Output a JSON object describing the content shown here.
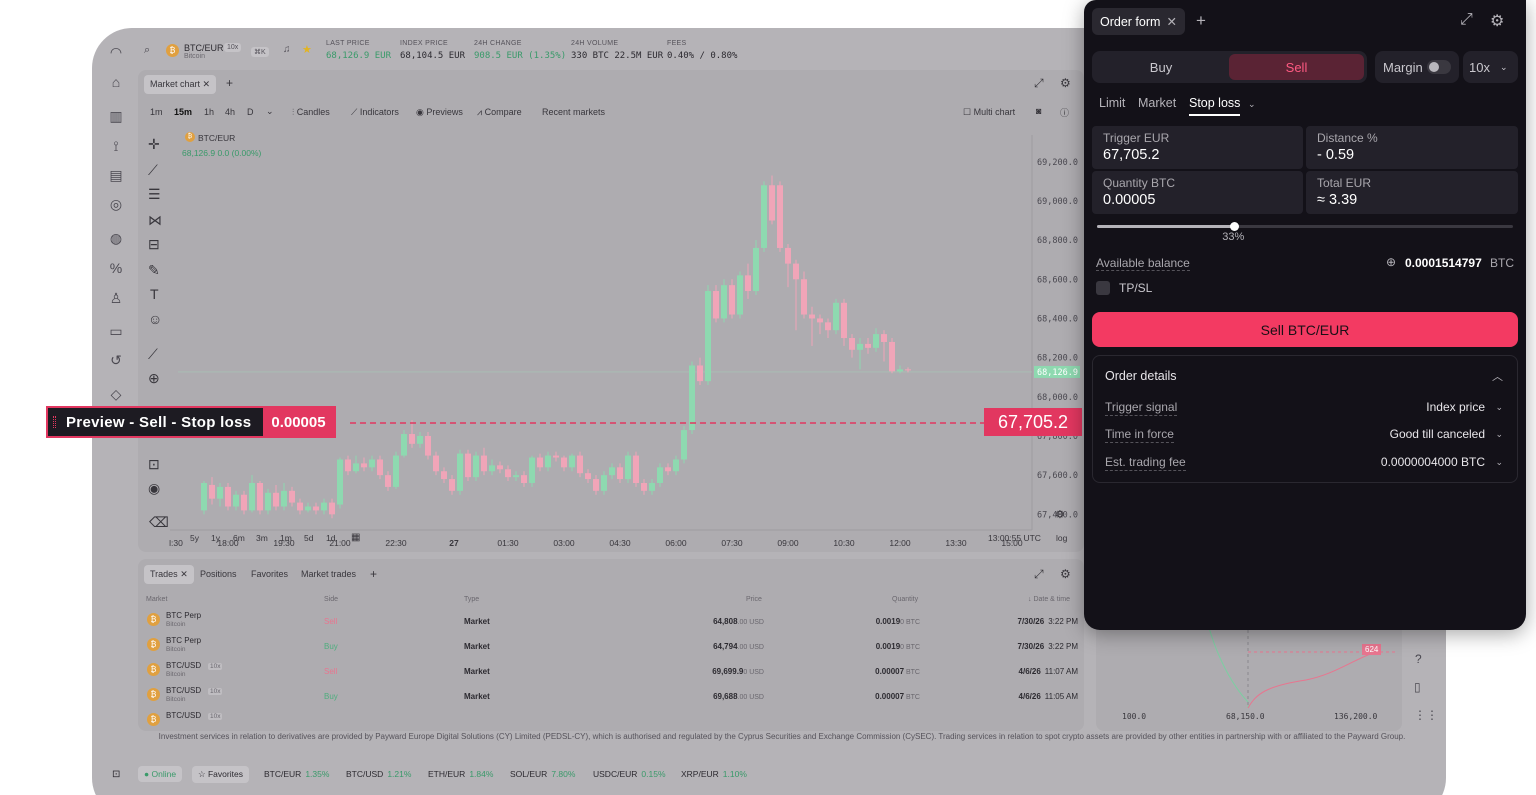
{
  "topbar": {
    "pair": "BTC/EUR",
    "pair_sub": "Bitcoin",
    "leverage_badge": "10x",
    "shortcut": "⌘K",
    "stats": [
      {
        "label": "LAST PRICE",
        "value": "68,126.9 EUR"
      },
      {
        "label": "INDEX PRICE",
        "value": "68,104.5 EUR"
      },
      {
        "label": "24H CHANGE",
        "value": "908.5 EUR (1.35%)"
      },
      {
        "label": "24H VOLUME",
        "value": "330 BTC  22.5M EUR"
      },
      {
        "label": "FEES",
        "value": "0.40% / 0.80%"
      }
    ]
  },
  "chart_panel": {
    "tab": "Market chart",
    "intervals": [
      "1m",
      "15m",
      "1h",
      "4h",
      "D"
    ],
    "tools": [
      "Candles",
      "Indicators",
      "Previews",
      "Compare",
      "Recent markets"
    ],
    "multi_chart": "Multi chart",
    "legend_pair": "BTC/EUR",
    "legend_value": "68,126.9  0.0 (0.00%)",
    "price_ticks": [
      "69,200.0",
      "69,000.0",
      "68,800.0",
      "68,600.0",
      "68,400.0",
      "68,200.0",
      "68,000.0",
      "67,800.0",
      "67,600.0",
      "67,400.0"
    ],
    "current_price_tag": "68,126.9",
    "time_ticks": [
      "l:30",
      "18:00",
      "19:30",
      "21:00",
      "22:30",
      "27",
      "01:30",
      "03:00",
      "04:30",
      "06:00",
      "07:30",
      "09:00",
      "10:30",
      "12:00",
      "13:30",
      "15:00"
    ],
    "ranges": [
      "5y",
      "1y",
      "6m",
      "3m",
      "1m",
      "5d",
      "1d"
    ],
    "clock": "13:00:55 UTC",
    "scale": "log"
  },
  "preview": {
    "label": "Preview - Sell - Stop loss",
    "qty": "0.00005",
    "price": "67,705.2"
  },
  "trades_panel": {
    "tabs": [
      "Trades",
      "Positions",
      "Favorites",
      "Market trades"
    ],
    "columns": [
      "Market",
      "Side",
      "Type",
      "Price",
      "Quantity",
      "Date & time"
    ],
    "rows": [
      {
        "market": "BTC Perp",
        "sub": "Bitcoin",
        "badge": "",
        "side": "Sell",
        "type": "Market",
        "price_main": "64,808",
        "price_dec": ".00 USD",
        "qty_main": "0.0019",
        "qty_dec": "0 BTC",
        "date": "7/30/26",
        "time": "3:22 PM"
      },
      {
        "market": "BTC Perp",
        "sub": "Bitcoin",
        "badge": "",
        "side": "Buy",
        "type": "Market",
        "price_main": "64,794",
        "price_dec": ".00 USD",
        "qty_main": "0.0019",
        "qty_dec": "0 BTC",
        "date": "7/30/26",
        "time": "3:22 PM"
      },
      {
        "market": "BTC/USD",
        "sub": "Bitcoin",
        "badge": "10x",
        "side": "Sell",
        "type": "Market",
        "price_main": "69,699.9",
        "price_dec": "0 USD",
        "qty_main": "0.00007",
        "qty_dec": " BTC",
        "date": "4/6/26",
        "time": "11:07 AM"
      },
      {
        "market": "BTC/USD",
        "sub": "Bitcoin",
        "badge": "10x",
        "side": "Buy",
        "type": "Market",
        "price_main": "69,688",
        "price_dec": ".00 USD",
        "qty_main": "0.00007",
        "qty_dec": " BTC",
        "date": "4/6/26",
        "time": "11:05 AM"
      },
      {
        "market": "BTC/USD",
        "sub": "",
        "badge": "10x",
        "side": "",
        "type": "",
        "price_main": "",
        "price_dec": "",
        "qty_main": "",
        "qty_dec": "",
        "date": "",
        "time": ""
      }
    ]
  },
  "depth": {
    "ticks": [
      "100.0",
      "68,150.0",
      "136,200.0"
    ],
    "badge": "624"
  },
  "footnote": "Investment services in relation to derivatives are provided by Payward Europe Digital Solutions (CY) Limited (PEDSL-CY), which is authorised and regulated by the Cyprus Securities and Exchange Commission (CySEC). Trading services in relation to spot crypto assets are provided by other entities in partnership with or affiliated to the Payward Group.",
  "bottombar": {
    "online": "Online",
    "favorites": "Favorites",
    "tickers": [
      {
        "pair": "BTC/EUR",
        "change": "1.35%"
      },
      {
        "pair": "BTC/USD",
        "change": "1.21%"
      },
      {
        "pair": "ETH/EUR",
        "change": "1.84%"
      },
      {
        "pair": "SOL/EUR",
        "change": "7.80%"
      },
      {
        "pair": "USDC/EUR",
        "change": "0.15%"
      },
      {
        "pair": "XRP/EUR",
        "change": "1.10%"
      }
    ]
  },
  "order_form": {
    "tab": "Order form",
    "buy": "Buy",
    "sell": "Sell",
    "margin": "Margin",
    "leverage": "10x",
    "order_types": [
      "Limit",
      "Market",
      "Stop loss"
    ],
    "trigger_label": "Trigger EUR",
    "trigger_value": "67,705.2",
    "distance_label": "Distance %",
    "distance_value": "-  0.59",
    "quantity_label": "Quantity BTC",
    "quantity_value": "0.00005",
    "total_label": "Total EUR",
    "total_value": "≈  3.39",
    "slider_fraction": 0.33,
    "slider_label": "33%",
    "available_label": "Available balance",
    "available_value": "0.0001514797",
    "available_unit": "BTC",
    "tpsl": "TP/SL",
    "submit": "Sell BTC/EUR",
    "details_title": "Order details",
    "details": [
      {
        "label": "Trigger signal",
        "value": "Index price"
      },
      {
        "label": "Time in force",
        "value": "Good till canceled"
      },
      {
        "label": "Est. trading fee",
        "value": "0.0000004000 BTC"
      }
    ]
  },
  "colors": {
    "sell_accent": "#f33a62",
    "up_candle": "#8ed9b0",
    "down_candle": "#f0a5b8",
    "panel_dark": "#131118"
  }
}
